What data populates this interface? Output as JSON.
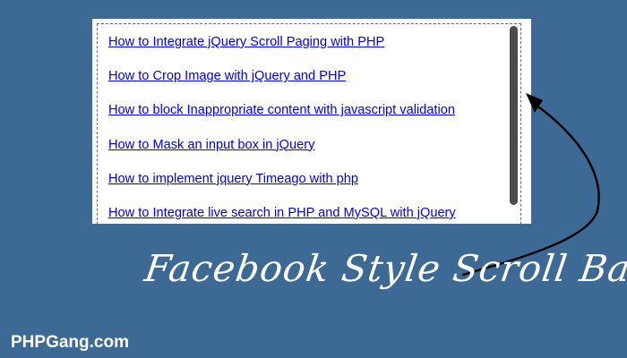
{
  "scroll_panel": {
    "links": [
      {
        "label": "How to Integrate jQuery Scroll Paging with PHP"
      },
      {
        "label": "How to Crop Image with jQuery and PHP"
      },
      {
        "label": "How to block Inappropriate content with javascript validation"
      },
      {
        "label": "How to Mask an input box in jQuery"
      },
      {
        "label": "How to implement jquery Timeago with php"
      },
      {
        "label": "How to Integrate live search in PHP and MySQL with jQuery"
      }
    ]
  },
  "tagline": "Facebook Style Scroll Bar",
  "brand": "PHPGang.com",
  "colors": {
    "background": "#3c6a94",
    "panel": "#ffffff",
    "link": "#0000ee",
    "scrollbar_thumb": "#4b4b4b",
    "arrow": "#000000"
  },
  "icons": {
    "arrow": "curved-arrow-icon"
  }
}
